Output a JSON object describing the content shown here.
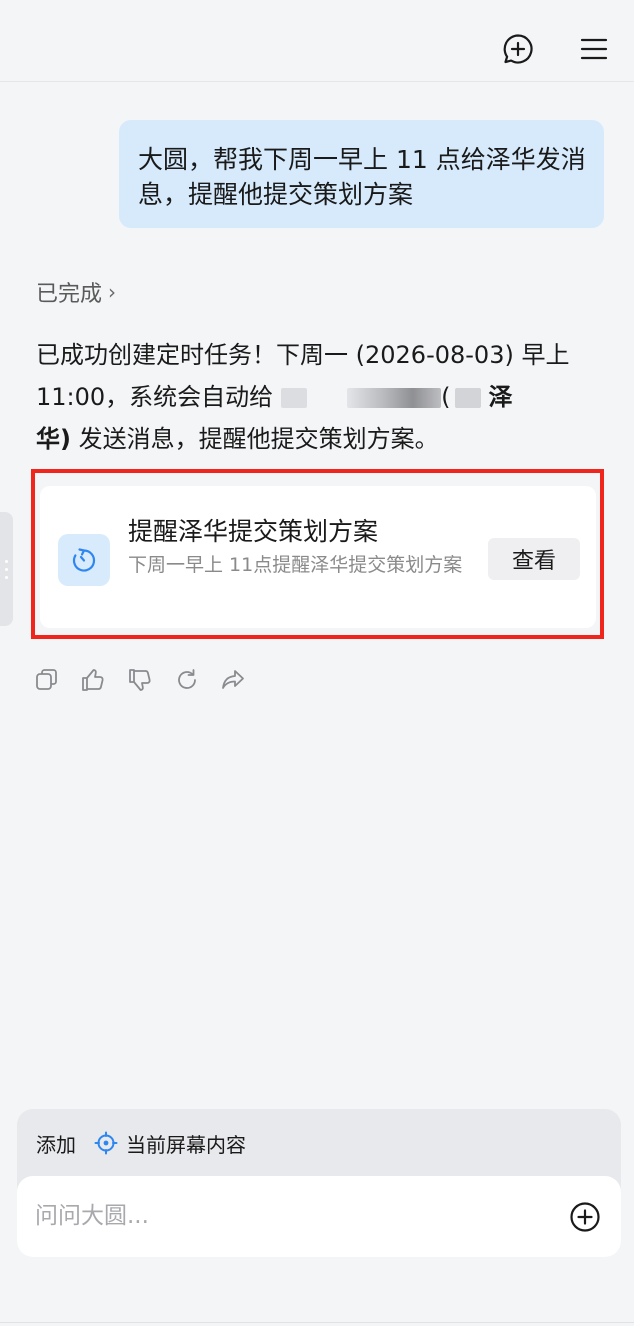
{
  "header": {
    "new_chat_icon": "chat-plus-icon",
    "menu_icon": "hamburger-menu-icon"
  },
  "user_message": {
    "text": "大圆，帮我下周一早上 11 点给泽华发消息，提醒他提交策划方案"
  },
  "status": {
    "label": "已完成",
    "chevron": "›"
  },
  "reply": {
    "part1": "已成功创建定时任务！下周一 (2026-08-03) 早上 11:00，系统会自动给",
    "paren_open": "(",
    "bold_name_1": "泽",
    "bold_name_2": "华)",
    "part2": " 发送消息，提醒他提交策划方案。"
  },
  "task_card": {
    "title": "提醒泽华提交策划方案",
    "subtitle": "下周一早上 11点提醒泽华提交策划方案",
    "button_label": "查看",
    "icon": "timer-icon",
    "accent_color": "#2e86f0",
    "highlight_color": "#f0251b"
  },
  "actions": [
    {
      "name": "copy-icon"
    },
    {
      "name": "thumbs-up-icon"
    },
    {
      "name": "thumbs-down-icon"
    },
    {
      "name": "regenerate-icon"
    },
    {
      "name": "share-icon"
    }
  ],
  "composer": {
    "add_label": "添加",
    "screen_chip_label": "当前屏幕内容",
    "placeholder": "问问大圆...",
    "plus_icon": "plus-circle-icon"
  }
}
